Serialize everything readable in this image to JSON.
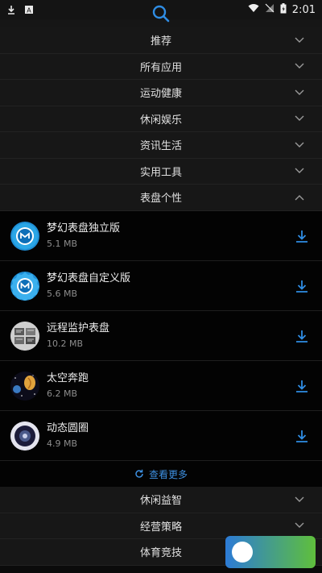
{
  "status": {
    "time": "2:01",
    "left_icons": [
      "download-icon",
      "a-icon"
    ],
    "right_icons": [
      "wifi-icon",
      "signal-icon",
      "battery-icon"
    ]
  },
  "search": {
    "icon": "search-icon",
    "color": "#2f8de4"
  },
  "categories_top": [
    {
      "label": "推荐"
    },
    {
      "label": "所有应用"
    },
    {
      "label": "运动健康"
    },
    {
      "label": "休闲娱乐"
    },
    {
      "label": "资讯生活"
    },
    {
      "label": "实用工具"
    },
    {
      "label": "表盘个性"
    }
  ],
  "apps": [
    {
      "name": "梦幻表盘独立版",
      "size": "5.1 MB",
      "icon": "watch-face-icon-1"
    },
    {
      "name": "梦幻表盘自定义版",
      "size": "5.6 MB",
      "icon": "watch-face-icon-2"
    },
    {
      "name": "远程监护表盘",
      "size": "10.2 MB",
      "icon": "remote-monitor-icon"
    },
    {
      "name": "太空奔跑",
      "size": "6.2 MB",
      "icon": "space-run-icon"
    },
    {
      "name": "动态圆圈",
      "size": "4.9 MB",
      "icon": "dynamic-circle-icon"
    }
  ],
  "more_label": "查看更多",
  "categories_bottom": [
    {
      "label": "休闲益智"
    },
    {
      "label": "经营策略"
    },
    {
      "label": "体育竞技"
    }
  ],
  "colors": {
    "accent": "#2f8de4"
  }
}
